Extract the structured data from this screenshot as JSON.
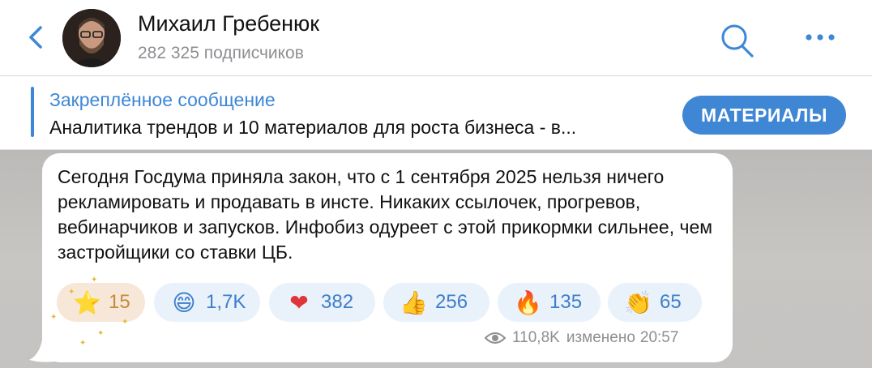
{
  "header": {
    "channel_name": "Михаил Гребенюк",
    "subscribers": "282 325 подписчиков",
    "back_icon": "chevron-left-icon",
    "search_icon": "search-icon",
    "more_icon": "more-dots-icon"
  },
  "pinned": {
    "label": "Закреплённое сообщение",
    "text": "Аналитика трендов и 10 материалов для роста бизнеса - в...",
    "button_label": "МАТЕРИАЛЫ"
  },
  "message": {
    "text": "Сегодня Госдума приняла закон, что с 1 сентября 2025 нельзя ничего рекламировать и продавать в инсте. Никаких ссылочек, прогревов, вебинарчиков и запусков. Инфобиз одуреет с этой прикормки сильнее, чем застройщики со ставки ЦБ.",
    "reactions": [
      {
        "emoji": "⭐",
        "icon": "star-icon",
        "count": "15"
      },
      {
        "emoji": "😄",
        "icon": "grin-icon",
        "count": "1,7K"
      },
      {
        "emoji": "❤",
        "icon": "heart-icon",
        "count": "382"
      },
      {
        "emoji": "👍",
        "icon": "thumbs-up-icon",
        "count": "256"
      },
      {
        "emoji": "🔥",
        "icon": "fire-icon",
        "count": "135"
      },
      {
        "emoji": "👏",
        "icon": "clap-icon",
        "count": "65"
      }
    ],
    "views": "110,8K",
    "edited_label": "изменено",
    "time": "20:57"
  },
  "colors": {
    "accent": "#3d87d6",
    "reaction_bg": "#e9f1fb",
    "star_reaction_bg": "#f6e7d9",
    "chat_bg": "#c4c2bf"
  }
}
